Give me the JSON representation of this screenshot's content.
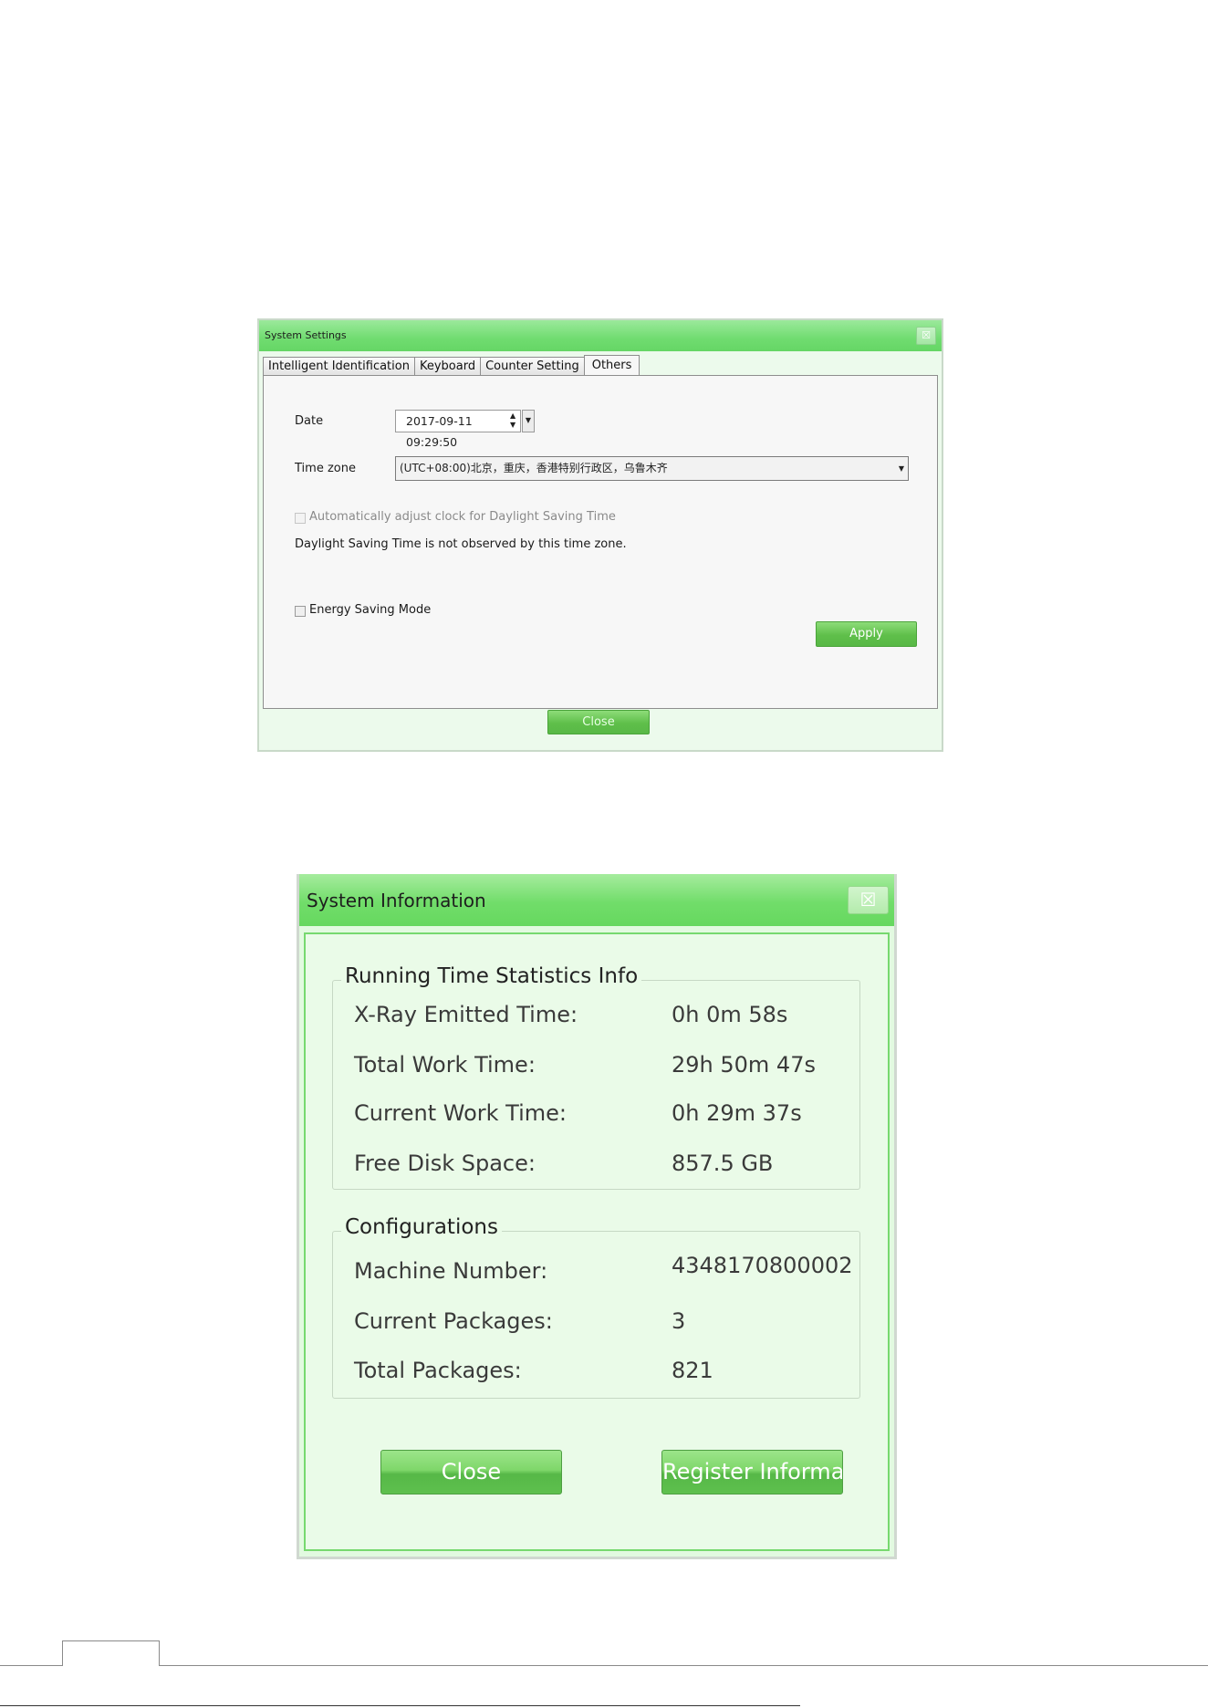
{
  "system_settings": {
    "title": "System Settings",
    "close_x": "☒",
    "tabs": [
      {
        "label": "Intelligent Identification"
      },
      {
        "label": "Keyboard"
      },
      {
        "label": "Counter Setting"
      },
      {
        "label": "Others"
      }
    ],
    "date_label": "Date",
    "date_value": "2017-09-11 09:29:50",
    "timezone_label": "Time zone",
    "timezone_value": "(UTC+08:00)北京，重庆，香港特别行政区，乌鲁木齐",
    "dst_checkbox_label": "Automatically adjust clock for Daylight Saving Time",
    "dst_note": "Daylight Saving Time is not observed by this time zone.",
    "energy_checkbox_label": "Energy Saving Mode",
    "apply_label": "Apply",
    "close_label": "Close"
  },
  "system_information": {
    "title": "System Information",
    "close_x": "☒",
    "running_group_title": "Running Time Statistics Info",
    "running": [
      {
        "label": "X-Ray Emitted Time:",
        "value": "0h 0m 58s"
      },
      {
        "label": "Total Work Time:",
        "value": "29h 50m 47s"
      },
      {
        "label": "Current Work Time:",
        "value": "0h 29m 37s"
      },
      {
        "label": "Free Disk Space:",
        "value": "857.5 GB"
      }
    ],
    "config_group_title": "Configurations",
    "config": [
      {
        "label": "Machine Number:",
        "value": "4348170800002"
      },
      {
        "label": "Current Packages:",
        "value": "3"
      },
      {
        "label": "Total Packages:",
        "value": "821"
      }
    ],
    "close_label": "Close",
    "register_label": "Register Informat"
  }
}
